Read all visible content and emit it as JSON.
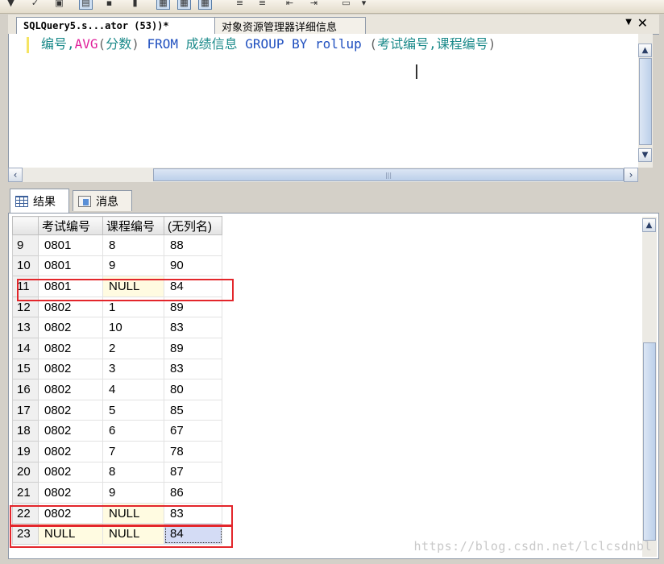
{
  "editor": {
    "active_tab": "SQLQuery5.s...ator (53))*",
    "inactive_tab": "对象资源管理器详细信息",
    "code": {
      "t1": "编号,",
      "t2": "AVG",
      "t3": "(",
      "t4": "分数",
      "t5": ")",
      "t6": " FROM ",
      "t7": "成绩信息",
      "t8": " GROUP BY ",
      "t9": "rollup ",
      "t10": "(",
      "t11": "考试编号,课程编号",
      "t12": ")"
    }
  },
  "results_tabs": {
    "results": "结果",
    "messages": "消息"
  },
  "grid": {
    "columns": [
      "考试编号",
      "课程编号",
      "(无列名)"
    ],
    "rows": [
      [
        "9",
        "0801",
        "8",
        "88"
      ],
      [
        "10",
        "0801",
        "9",
        "90"
      ],
      [
        "11",
        "0801",
        "NULL",
        "84"
      ],
      [
        "12",
        "0802",
        "1",
        "89"
      ],
      [
        "13",
        "0802",
        "10",
        "83"
      ],
      [
        "14",
        "0802",
        "2",
        "89"
      ],
      [
        "15",
        "0802",
        "3",
        "83"
      ],
      [
        "16",
        "0802",
        "4",
        "80"
      ],
      [
        "17",
        "0802",
        "5",
        "85"
      ],
      [
        "18",
        "0802",
        "6",
        "67"
      ],
      [
        "19",
        "0802",
        "7",
        "78"
      ],
      [
        "20",
        "0802",
        "8",
        "87"
      ],
      [
        "21",
        "0802",
        "9",
        "86"
      ],
      [
        "22",
        "0802",
        "NULL",
        "83"
      ],
      [
        "23",
        "NULL",
        "NULL",
        "84"
      ]
    ]
  },
  "watermark": "https://blog.csdn.net/lclcsdnbl",
  "colors": {
    "highlight_box": "#e3262b",
    "keyword": "#1f4fbf",
    "identifier": "#1b8a8a",
    "function": "#e0209b"
  }
}
